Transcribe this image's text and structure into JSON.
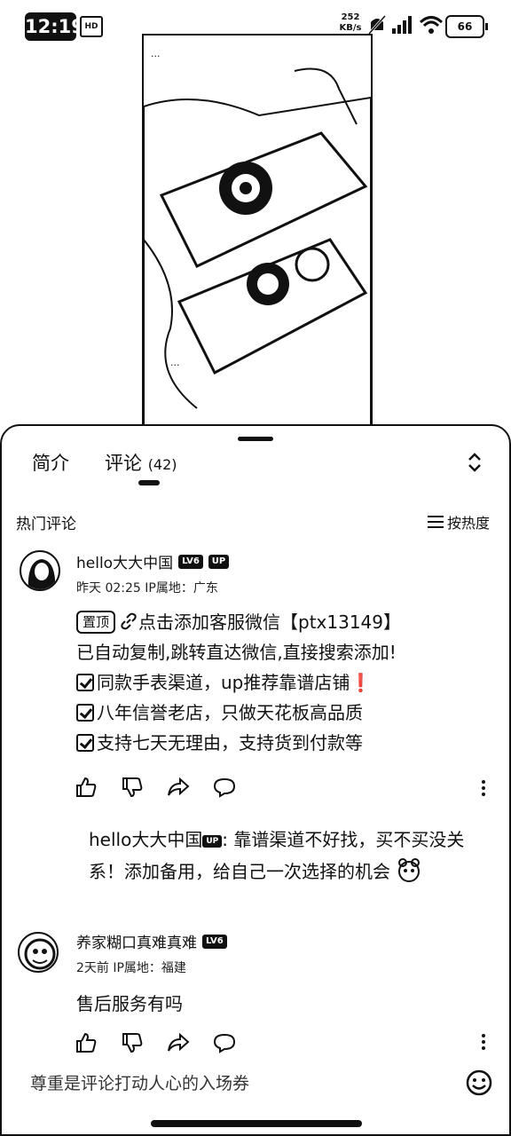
{
  "status_bar": {
    "time": "12:19",
    "sim_label": "HD",
    "net_speed": "252\nKB/s",
    "battery": "66"
  },
  "video": {
    "caption_top": "...",
    "caption_bottom": "..."
  },
  "tabs": [
    {
      "label": "简介"
    },
    {
      "label": "评论",
      "count": "(42)"
    }
  ],
  "hot_comments_title": "热门评论",
  "sort_label": "按热度",
  "comments": [
    {
      "username": "hello大大中国",
      "level_badge": "LV6",
      "up_badge": "UP",
      "meta": "昨天 02:25  IP属地：广东",
      "pinned_label": "置顶",
      "lines": [
        "点击添加客服微信【ptx13149】",
        "已自动复制,跳转直达微信,直接搜索添加!",
        "同款手表渠道，up推荐靠谱店铺❗",
        "八年信誉老店，只做天花板高品质",
        "支持七天无理由，支持货到付款等"
      ],
      "reply": {
        "username": "hello大大中国",
        "up_badge": "UP",
        "text": ": 靠谱渠道不好找，买不买没关系！添加备用，给自己一次选择的机会"
      }
    },
    {
      "username": "养家糊口真难真难",
      "level_badge": "LV6",
      "meta": "2天前  IP属地：福建",
      "text": "售后服务有吗"
    }
  ],
  "input": {
    "placeholder": "尊重是评论打动人心的入场券"
  },
  "icons": [
    "like-icon",
    "dislike-icon",
    "share-icon",
    "reply-icon",
    "more-icon",
    "sort-icon",
    "expand-icon",
    "link-icon",
    "emoji-icon"
  ]
}
